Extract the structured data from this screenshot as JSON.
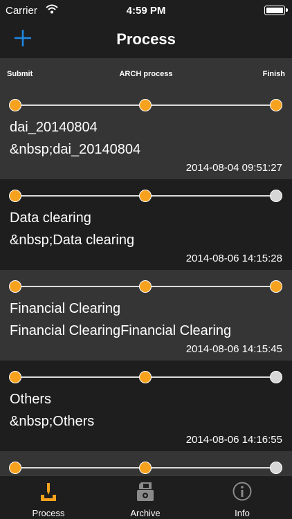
{
  "statusbar": {
    "carrier": "Carrier",
    "time": "4:59 PM"
  },
  "navbar": {
    "title": "Process",
    "add_icon": "plus-icon"
  },
  "stages": {
    "submit": "Submit",
    "arch": "ARCH process",
    "finish": "Finish"
  },
  "colors": {
    "accent": "#f6a21e",
    "blue": "#1e88e5",
    "inactive_dot": "#d6d6d6"
  },
  "items": [
    {
      "name": "dai_20140804",
      "description": "&nbsp;dai_20140804",
      "date": "2014-08-04 09:51:27",
      "progress": [
        true,
        true,
        true
      ]
    },
    {
      "name": "Data clearing",
      "description": "&nbsp;Data clearing",
      "date": "2014-08-06 14:15:28",
      "progress": [
        true,
        true,
        false
      ]
    },
    {
      "name": "Financial Clearing",
      "description": "Financial ClearingFinancial Clearing",
      "date": "2014-08-06 14:15:45",
      "progress": [
        true,
        true,
        true
      ]
    },
    {
      "name": "Others",
      "description": "&nbsp;Others",
      "date": "2014-08-06 14:16:55",
      "progress": [
        true,
        true,
        false
      ]
    },
    {
      "name": "",
      "description": "",
      "date": "",
      "progress": [
        true,
        true,
        false
      ]
    }
  ],
  "tabs": [
    {
      "label": "Process",
      "icon": "process-icon",
      "active": true
    },
    {
      "label": "Archive",
      "icon": "archive-icon",
      "active": false
    },
    {
      "label": "Info",
      "icon": "info-icon",
      "active": false
    }
  ]
}
